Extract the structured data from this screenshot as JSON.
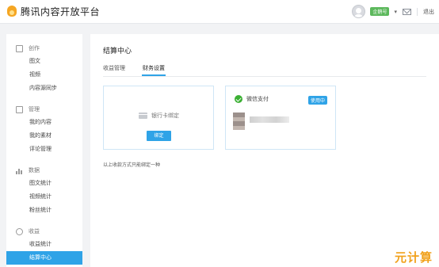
{
  "app": {
    "logo_text": "腾讯内容开放平台"
  },
  "header": {
    "badge": "企鹅号",
    "logout": "退出",
    "caret": "▾"
  },
  "sidebar": {
    "groups": [
      {
        "title": "创作",
        "items": [
          "图文",
          "视频",
          "内容源同步"
        ]
      },
      {
        "title": "管理",
        "items": [
          "我的内容",
          "我的素材",
          "评论管理"
        ]
      },
      {
        "title": "数据",
        "items": [
          "图文统计",
          "视频统计",
          "粉丝统计"
        ]
      },
      {
        "title": "收益",
        "items": [
          "收益统计",
          "结算中心"
        ]
      }
    ],
    "active_item": "结算中心"
  },
  "main": {
    "title": "结算中心",
    "tabs": [
      "收益管理",
      "财务设置"
    ],
    "active_tab": "财务设置",
    "bank_card": {
      "label": "银行卡绑定",
      "button": "绑定"
    },
    "wechat_card": {
      "label": "微信支付",
      "tag": "使用中"
    },
    "note": "以上收款方式只能绑定一种"
  },
  "watermark": "元计算",
  "colors": {
    "accent": "#2fa3e7",
    "wechat_green": "#3cb034",
    "badge_green": "#5cb85c",
    "watermark": "#f1a11b"
  }
}
